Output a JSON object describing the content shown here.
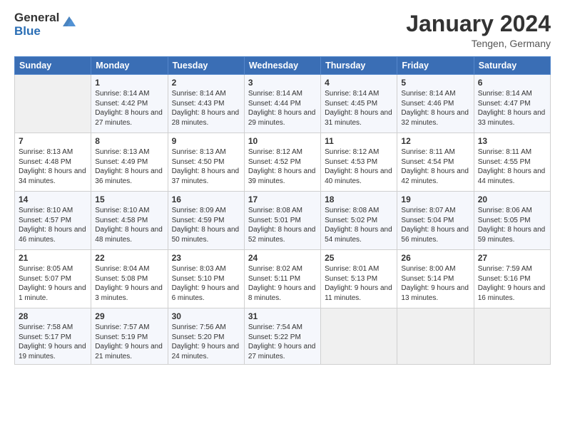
{
  "header": {
    "logo_general": "General",
    "logo_blue": "Blue",
    "month_title": "January 2024",
    "location": "Tengen, Germany"
  },
  "weekdays": [
    "Sunday",
    "Monday",
    "Tuesday",
    "Wednesday",
    "Thursday",
    "Friday",
    "Saturday"
  ],
  "weeks": [
    [
      {
        "day": "",
        "empty": true
      },
      {
        "day": "1",
        "sunrise": "Sunrise: 8:14 AM",
        "sunset": "Sunset: 4:42 PM",
        "daylight": "Daylight: 8 hours and 27 minutes."
      },
      {
        "day": "2",
        "sunrise": "Sunrise: 8:14 AM",
        "sunset": "Sunset: 4:43 PM",
        "daylight": "Daylight: 8 hours and 28 minutes."
      },
      {
        "day": "3",
        "sunrise": "Sunrise: 8:14 AM",
        "sunset": "Sunset: 4:44 PM",
        "daylight": "Daylight: 8 hours and 29 minutes."
      },
      {
        "day": "4",
        "sunrise": "Sunrise: 8:14 AM",
        "sunset": "Sunset: 4:45 PM",
        "daylight": "Daylight: 8 hours and 31 minutes."
      },
      {
        "day": "5",
        "sunrise": "Sunrise: 8:14 AM",
        "sunset": "Sunset: 4:46 PM",
        "daylight": "Daylight: 8 hours and 32 minutes."
      },
      {
        "day": "6",
        "sunrise": "Sunrise: 8:14 AM",
        "sunset": "Sunset: 4:47 PM",
        "daylight": "Daylight: 8 hours and 33 minutes."
      }
    ],
    [
      {
        "day": "7",
        "sunrise": "Sunrise: 8:13 AM",
        "sunset": "Sunset: 4:48 PM",
        "daylight": "Daylight: 8 hours and 34 minutes."
      },
      {
        "day": "8",
        "sunrise": "Sunrise: 8:13 AM",
        "sunset": "Sunset: 4:49 PM",
        "daylight": "Daylight: 8 hours and 36 minutes."
      },
      {
        "day": "9",
        "sunrise": "Sunrise: 8:13 AM",
        "sunset": "Sunset: 4:50 PM",
        "daylight": "Daylight: 8 hours and 37 minutes."
      },
      {
        "day": "10",
        "sunrise": "Sunrise: 8:12 AM",
        "sunset": "Sunset: 4:52 PM",
        "daylight": "Daylight: 8 hours and 39 minutes."
      },
      {
        "day": "11",
        "sunrise": "Sunrise: 8:12 AM",
        "sunset": "Sunset: 4:53 PM",
        "daylight": "Daylight: 8 hours and 40 minutes."
      },
      {
        "day": "12",
        "sunrise": "Sunrise: 8:11 AM",
        "sunset": "Sunset: 4:54 PM",
        "daylight": "Daylight: 8 hours and 42 minutes."
      },
      {
        "day": "13",
        "sunrise": "Sunrise: 8:11 AM",
        "sunset": "Sunset: 4:55 PM",
        "daylight": "Daylight: 8 hours and 44 minutes."
      }
    ],
    [
      {
        "day": "14",
        "sunrise": "Sunrise: 8:10 AM",
        "sunset": "Sunset: 4:57 PM",
        "daylight": "Daylight: 8 hours and 46 minutes."
      },
      {
        "day": "15",
        "sunrise": "Sunrise: 8:10 AM",
        "sunset": "Sunset: 4:58 PM",
        "daylight": "Daylight: 8 hours and 48 minutes."
      },
      {
        "day": "16",
        "sunrise": "Sunrise: 8:09 AM",
        "sunset": "Sunset: 4:59 PM",
        "daylight": "Daylight: 8 hours and 50 minutes."
      },
      {
        "day": "17",
        "sunrise": "Sunrise: 8:08 AM",
        "sunset": "Sunset: 5:01 PM",
        "daylight": "Daylight: 8 hours and 52 minutes."
      },
      {
        "day": "18",
        "sunrise": "Sunrise: 8:08 AM",
        "sunset": "Sunset: 5:02 PM",
        "daylight": "Daylight: 8 hours and 54 minutes."
      },
      {
        "day": "19",
        "sunrise": "Sunrise: 8:07 AM",
        "sunset": "Sunset: 5:04 PM",
        "daylight": "Daylight: 8 hours and 56 minutes."
      },
      {
        "day": "20",
        "sunrise": "Sunrise: 8:06 AM",
        "sunset": "Sunset: 5:05 PM",
        "daylight": "Daylight: 8 hours and 59 minutes."
      }
    ],
    [
      {
        "day": "21",
        "sunrise": "Sunrise: 8:05 AM",
        "sunset": "Sunset: 5:07 PM",
        "daylight": "Daylight: 9 hours and 1 minute."
      },
      {
        "day": "22",
        "sunrise": "Sunrise: 8:04 AM",
        "sunset": "Sunset: 5:08 PM",
        "daylight": "Daylight: 9 hours and 3 minutes."
      },
      {
        "day": "23",
        "sunrise": "Sunrise: 8:03 AM",
        "sunset": "Sunset: 5:10 PM",
        "daylight": "Daylight: 9 hours and 6 minutes."
      },
      {
        "day": "24",
        "sunrise": "Sunrise: 8:02 AM",
        "sunset": "Sunset: 5:11 PM",
        "daylight": "Daylight: 9 hours and 8 minutes."
      },
      {
        "day": "25",
        "sunrise": "Sunrise: 8:01 AM",
        "sunset": "Sunset: 5:13 PM",
        "daylight": "Daylight: 9 hours and 11 minutes."
      },
      {
        "day": "26",
        "sunrise": "Sunrise: 8:00 AM",
        "sunset": "Sunset: 5:14 PM",
        "daylight": "Daylight: 9 hours and 13 minutes."
      },
      {
        "day": "27",
        "sunrise": "Sunrise: 7:59 AM",
        "sunset": "Sunset: 5:16 PM",
        "daylight": "Daylight: 9 hours and 16 minutes."
      }
    ],
    [
      {
        "day": "28",
        "sunrise": "Sunrise: 7:58 AM",
        "sunset": "Sunset: 5:17 PM",
        "daylight": "Daylight: 9 hours and 19 minutes."
      },
      {
        "day": "29",
        "sunrise": "Sunrise: 7:57 AM",
        "sunset": "Sunset: 5:19 PM",
        "daylight": "Daylight: 9 hours and 21 minutes."
      },
      {
        "day": "30",
        "sunrise": "Sunrise: 7:56 AM",
        "sunset": "Sunset: 5:20 PM",
        "daylight": "Daylight: 9 hours and 24 minutes."
      },
      {
        "day": "31",
        "sunrise": "Sunrise: 7:54 AM",
        "sunset": "Sunset: 5:22 PM",
        "daylight": "Daylight: 9 hours and 27 minutes."
      },
      {
        "day": "",
        "empty": true
      },
      {
        "day": "",
        "empty": true
      },
      {
        "day": "",
        "empty": true
      }
    ]
  ]
}
